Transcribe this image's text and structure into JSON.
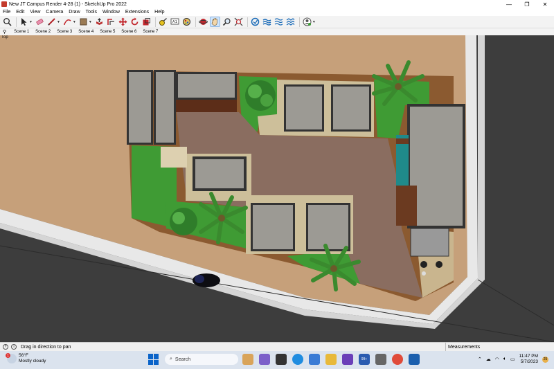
{
  "window": {
    "title": "New JT Campus Render 4-28 (1) - SketchUp Pro 2022",
    "controls": [
      "—",
      "❐",
      "✕"
    ]
  },
  "menu": [
    "File",
    "Edit",
    "View",
    "Camera",
    "Draw",
    "Tools",
    "Window",
    "Extensions",
    "Help"
  ],
  "scenes": [
    "Scene 1",
    "Scene 2",
    "Scene 3",
    "Scene 4",
    "Scene 5",
    "Scene 6",
    "Scene 7"
  ],
  "viewport": {
    "view_label": "Top"
  },
  "status": {
    "hint": "Drag in direction to pan",
    "measurements_label": "Measurements"
  },
  "taskbar": {
    "weather_temp": "56°F",
    "weather_desc": "Mostly cloudy",
    "weather_badge": "1",
    "search_placeholder": "Search",
    "time": "11:47 PM",
    "date": "5/7/2023",
    "notif_badge": "99+",
    "tray_badge": "25"
  },
  "colors": {
    "dirt": "#c6a07a",
    "paving": "#8a6d60",
    "grass": "#3f9b34",
    "road": "#3d3d3d",
    "sidewalk": "#e8e8e8",
    "roof": "#9c9a94"
  }
}
